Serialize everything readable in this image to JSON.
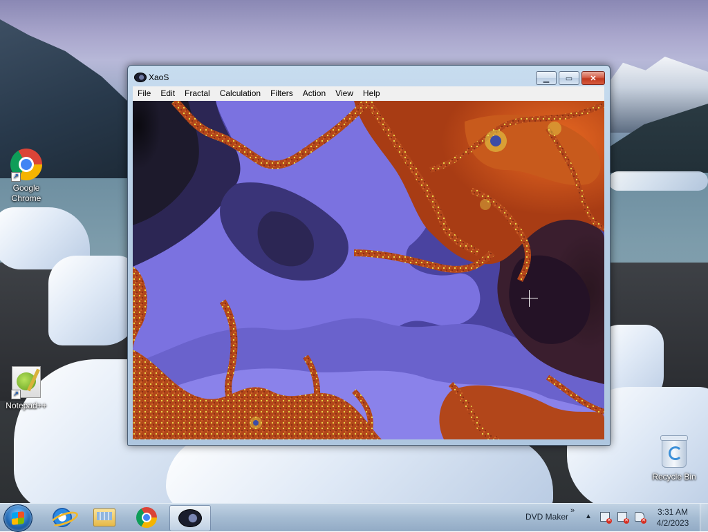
{
  "desktop": {
    "icons": [
      {
        "label_line1": "Google",
        "label_line2": "Chrome",
        "icon": "chrome-icon"
      },
      {
        "label_line1": "Notepad++",
        "label_line2": "",
        "icon": "notepad-plus-plus-icon"
      },
      {
        "label_line1": "Recycle Bin",
        "label_line2": "",
        "icon": "recycle-bin-icon"
      }
    ]
  },
  "window": {
    "title": "XaoS",
    "icon": "xaos-app-icon",
    "controls": {
      "minimize": "minimize-icon",
      "maximize": "maximize-icon",
      "close": "close-icon"
    },
    "menu": [
      "File",
      "Edit",
      "Fractal",
      "Calculation",
      "Filters",
      "Action",
      "View",
      "Help"
    ],
    "fractal": {
      "palette": {
        "void": "#0d0b14",
        "violet_dark": "#2c2654",
        "violet_mid": "#4a43a0",
        "violet_light": "#7b72e0",
        "orange": "#c24a14",
        "orange_bright": "#ea6a22",
        "gold": "#e8d84a",
        "plum": "#3a1e2e"
      }
    }
  },
  "taskbar": {
    "start_icon": "windows-start-icon",
    "pinned": [
      "internet-explorer-icon",
      "file-explorer-icon",
      "chrome-icon",
      "xaos-icon"
    ],
    "tray_label": "DVD Maker",
    "chevron": "»",
    "tray_icons": [
      "flag-alert-icon",
      "network-alert-icon",
      "volume-muted-icon"
    ],
    "time": "3:31 AM",
    "date": "4/2/2023"
  }
}
